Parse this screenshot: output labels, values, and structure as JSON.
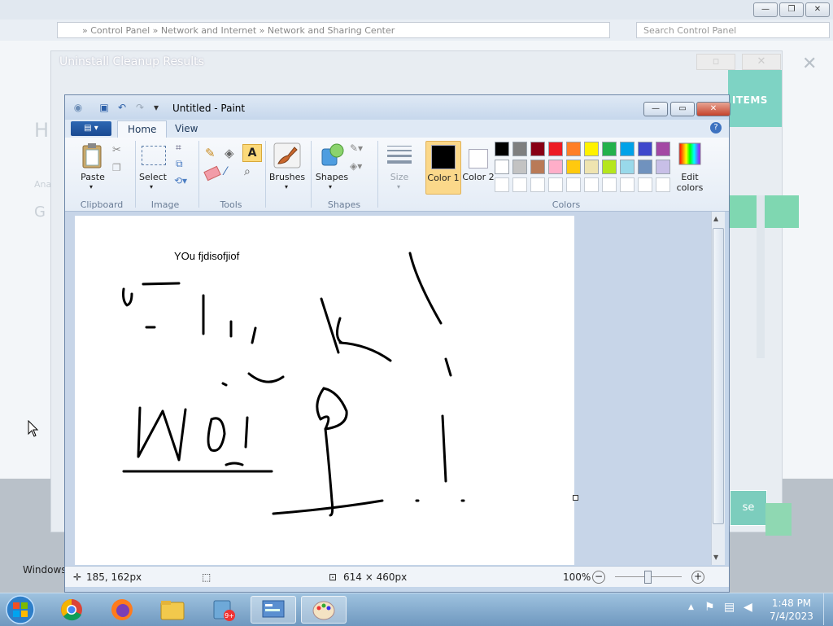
{
  "background_window": {
    "address_text": "» Control Panel » Network and Internet » Network and Sharing Center",
    "search_placeholder": "Search Control Panel",
    "windows_text": "Windows"
  },
  "uninstall_dialog": {
    "title": "Uninstall Cleanup Results",
    "items_label": "ITEMS",
    "close_label": "se",
    "left_heading": "H",
    "left_sub": "Ana",
    "left_g": "G"
  },
  "paint": {
    "window_title": "Untitled - Paint",
    "tabs": [
      "Home",
      "View"
    ],
    "groups": {
      "clipboard": {
        "label": "Clipboard",
        "paste": "Paste"
      },
      "image": {
        "label": "Image",
        "select": "Select"
      },
      "tools": {
        "label": "Tools"
      },
      "brushes": {
        "label": "Brushes"
      },
      "shapes": {
        "label": "Shapes",
        "shapes_btn": "Shapes"
      },
      "size": {
        "label": "Size"
      },
      "colors": {
        "label": "Colors",
        "color1": "Color 1",
        "color2": "Color 2",
        "edit": "Edit colors",
        "color1_value": "#000000",
        "color2_value": "#ffffff",
        "palette_row1": [
          "#000000",
          "#7f7f7f",
          "#880015",
          "#ed1c24",
          "#ff7f27",
          "#fff200",
          "#22b14c",
          "#00a2e8",
          "#3f48cc",
          "#a349a4"
        ],
        "palette_row2": [
          "#ffffff",
          "#c3c3c3",
          "#b97a57",
          "#ffaec9",
          "#ffc90e",
          "#efe4b0",
          "#b5e61d",
          "#99d9ea",
          "#7092be",
          "#c8bfe7"
        ]
      }
    },
    "canvas_text": "YOu fjdisofjiof",
    "status": {
      "cursor_pos": "185, 162px",
      "image_size": "614 × 460px",
      "zoom": "100%"
    }
  },
  "taskbar": {
    "time": "1:48 PM",
    "date": "7/4/2023"
  }
}
